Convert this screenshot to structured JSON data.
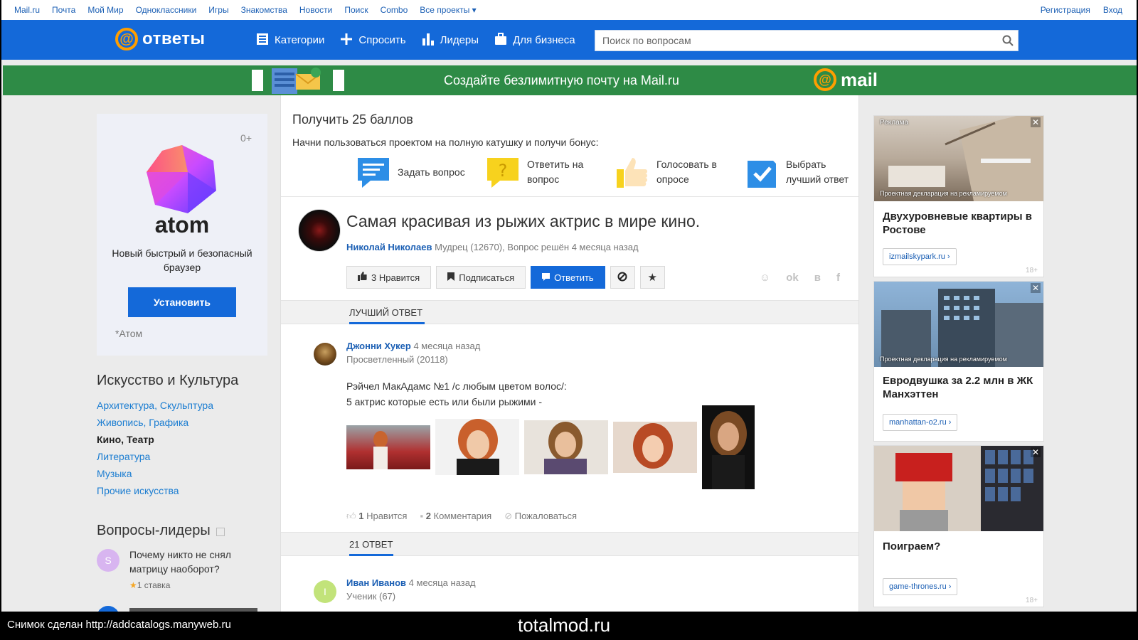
{
  "portal": {
    "links": [
      "Mail.ru",
      "Почта",
      "Мой Мир",
      "Одноклассники",
      "Игры",
      "Знакомства",
      "Новости",
      "Поиск",
      "Combo"
    ],
    "all_projects": "Все проекты",
    "register": "Регистрация",
    "login": "Вход"
  },
  "header": {
    "logo_text": "ответы",
    "nav": [
      "Категории",
      "Спросить",
      "Лидеры",
      "Для бизнеса"
    ],
    "search_placeholder": "Поиск по вопросам",
    "brand_color": "#1469d9",
    "accent_color": "#ff9e00"
  },
  "promo": {
    "text": "Создайте безлимитную почту на Mail.ru",
    "logo": "mail"
  },
  "atom_ad": {
    "age": "0+",
    "brand": "atom",
    "description": "Новый быстрый и безопасный браузер",
    "install": "Установить",
    "footnote": "*Атом"
  },
  "categories": {
    "title": "Искусство и Культура",
    "items": [
      {
        "label": "Архитектура, Скульптура",
        "active": false
      },
      {
        "label": "Живопись, Графика",
        "active": false
      },
      {
        "label": "Кино, Театр",
        "active": true
      },
      {
        "label": "Литература",
        "active": false
      },
      {
        "label": "Музыка",
        "active": false
      },
      {
        "label": "Прочие искусства",
        "active": false
      }
    ]
  },
  "leaders": {
    "title": "Вопросы-лидеры",
    "items": [
      {
        "avatar_letter": "S",
        "question": "Почему никто не снял матрицу наоборот?",
        "bid": "1 ставка"
      }
    ]
  },
  "bonus": {
    "title": "Получить 25 баллов",
    "subtitle": "Начни пользоваться проектом на полную катушку и получи бонус:",
    "steps": [
      {
        "icon": "speech-bubble-icon",
        "label": "Задать вопрос"
      },
      {
        "icon": "question-bubble-icon",
        "label": "Ответить на вопрос"
      },
      {
        "icon": "thumbs-up-icon",
        "label": "Голосовать в опросе"
      },
      {
        "icon": "checkmark-icon",
        "label": "Выбрать лучший ответ"
      }
    ]
  },
  "question": {
    "title": "Самая красивая из рыжих актрис в мире кино.",
    "author": "Николай Николаев",
    "meta": "Мудрец (12670), Вопрос решён 4 месяца назад",
    "like": "3 Нравится",
    "subscribe": "Подписаться",
    "answer": "Ответить",
    "share": [
      "☺",
      "ok",
      "в",
      "f"
    ]
  },
  "best_answer": {
    "section": "Лучший ответ",
    "author": "Джонни Хукер",
    "time": "4 месяца назад",
    "rank": "Просветленный (20118)",
    "text_line1": "Рэйчел МакАдамс №1 /с любым цветом волос/:",
    "text_line2": "5 актрис которые есть или были рыжими -",
    "likes_num": "1",
    "likes_label": "Нравится",
    "comments_num": "2",
    "comments_label": "Комментария",
    "report": "Пожаловаться"
  },
  "answers": {
    "section": "21 ответ",
    "first": {
      "avatar_letter": "I",
      "author": "Иван Иванов",
      "time": "4 месяца назад",
      "rank": "Ученик (67)"
    }
  },
  "ads": [
    {
      "tag": "Реклама",
      "declaration": "Проектная декларация на рекламируемом",
      "title": "Двухуровневые квартиры в Ростове",
      "link": "izmailskypark.ru ›",
      "age": "18+"
    },
    {
      "declaration": "Проектная декларация на рекламируемом",
      "title": "Евродвушка за 2.2 млн в ЖК Манхэттен",
      "link": "manhattan-o2.ru ›"
    },
    {
      "title": "Поиграем?",
      "link": "game-thrones.ru ›",
      "age": "18+"
    }
  ],
  "footer": {
    "caption": "Снимок сделан http://addcatalogs.manyweb.ru",
    "watermark": "totalmod.ru"
  }
}
